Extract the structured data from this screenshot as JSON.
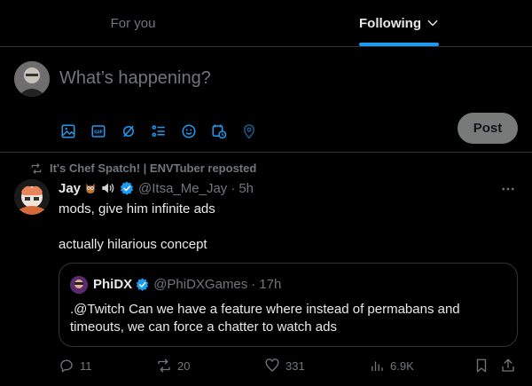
{
  "tabs": [
    {
      "label": "For you",
      "active": false
    },
    {
      "label": "Following",
      "active": true
    }
  ],
  "composer": {
    "placeholder": "What’s happening?",
    "post_label": "Post",
    "tools": [
      "image-icon",
      "gif-icon",
      "grok-icon",
      "poll-icon",
      "emoji-icon",
      "schedule-icon",
      "location-icon"
    ]
  },
  "tweet": {
    "reposted_by": "It's Chef Spatch! | ENVTuber reposted",
    "author_name": "Jay",
    "author_handle": "@Itsa_Me_Jay",
    "separator": "·",
    "time": "5h",
    "text": "mods, give him infinite ads\n\nactually hilarious concept",
    "quote": {
      "author_name": "PhiDX",
      "author_handle": "@PhiDXGames",
      "separator": "·",
      "time": "17h",
      "text": ".@Twitch Can we have a feature where instead of permabans and timeouts, we can force a chatter to watch ads"
    },
    "stats": {
      "replies": "11",
      "reposts": "20",
      "likes": "331",
      "views": "6.9K"
    }
  },
  "colors": {
    "accent": "#1d9bf0",
    "muted": "#71767b",
    "text": "#e7e9ea",
    "border": "#2f3336"
  }
}
